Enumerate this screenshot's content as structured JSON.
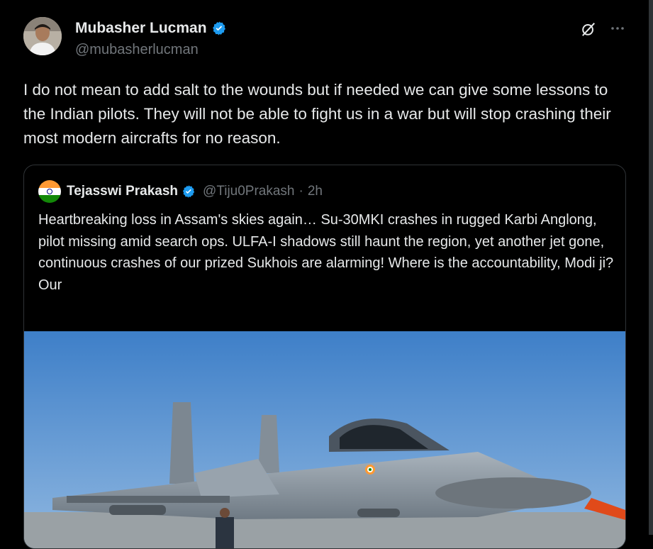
{
  "author": {
    "name": "Mubasher Lucman",
    "handle": "@mubasherlucman"
  },
  "tweet": {
    "text": "I do not mean to add salt to the wounds but if needed we can give some lessons to the Indian pilots. They will not be able to fight us in a war but will stop crashing their most modern aircrafts for no reason."
  },
  "quoted": {
    "name": "Tejasswi Prakash",
    "handle": "@Tiju0Prakash",
    "separator": "·",
    "time": "2h",
    "text": "Heartbreaking loss in Assam's skies again… Su-30MKI crashes in rugged Karbi Anglong, pilot missing amid search ops. ULFA-I shadows still haunt the region, yet another jet gone, continuous crashes of our prized Sukhois are alarming! Where is the accountability, Modi ji?\nOur"
  },
  "icons": {
    "verified": "verified-badge-icon",
    "grok": "grok-icon",
    "more": "more-icon"
  },
  "colors": {
    "background": "#000000",
    "text": "#e7e9ea",
    "secondary": "#71767b",
    "verified": "#1d9bf0",
    "border": "#2f3336"
  }
}
